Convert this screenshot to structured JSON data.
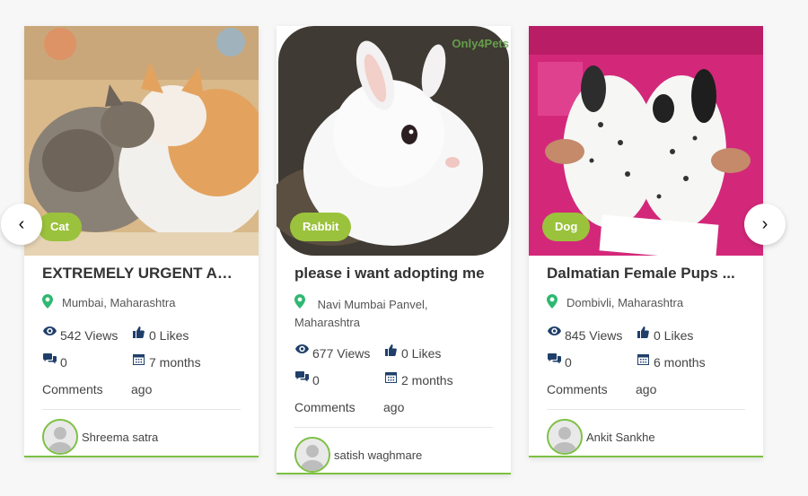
{
  "carousel": {
    "prev_label": "‹",
    "next_label": "›",
    "cards": [
      {
        "category": "Cat",
        "title": "EXTREMELY URGENT AD...",
        "location": "Mumbai, Maharashtra",
        "views": "542 Views",
        "likes": "0 Likes",
        "comments_count": "0",
        "comments_label": "Comments",
        "age": "7 months",
        "age_suffix": "ago",
        "author": "Shreema satra"
      },
      {
        "category": "Rabbit",
        "title": "please i want adopting me",
        "location": "Navi Mumbai Panvel, Maharashtra",
        "views": "677 Views",
        "likes": "0 Likes",
        "comments_count": "0",
        "comments_label": "Comments",
        "age": "2 months",
        "age_suffix": "ago",
        "author": "satish waghmare",
        "watermark": "Only4Pets"
      },
      {
        "category": "Dog",
        "title": "Dalmatian Female Pups ...",
        "location": "Dombivli, Maharashtra",
        "views": "845 Views",
        "likes": "0 Likes",
        "comments_count": "0",
        "comments_label": "Comments",
        "age": "6 months",
        "age_suffix": "ago",
        "author": "Ankit Sankhe"
      }
    ]
  },
  "colors": {
    "accent": "#7cc142",
    "badge": "#9bc23c",
    "pin": "#2eb872",
    "icon": "#1f3f6a"
  }
}
